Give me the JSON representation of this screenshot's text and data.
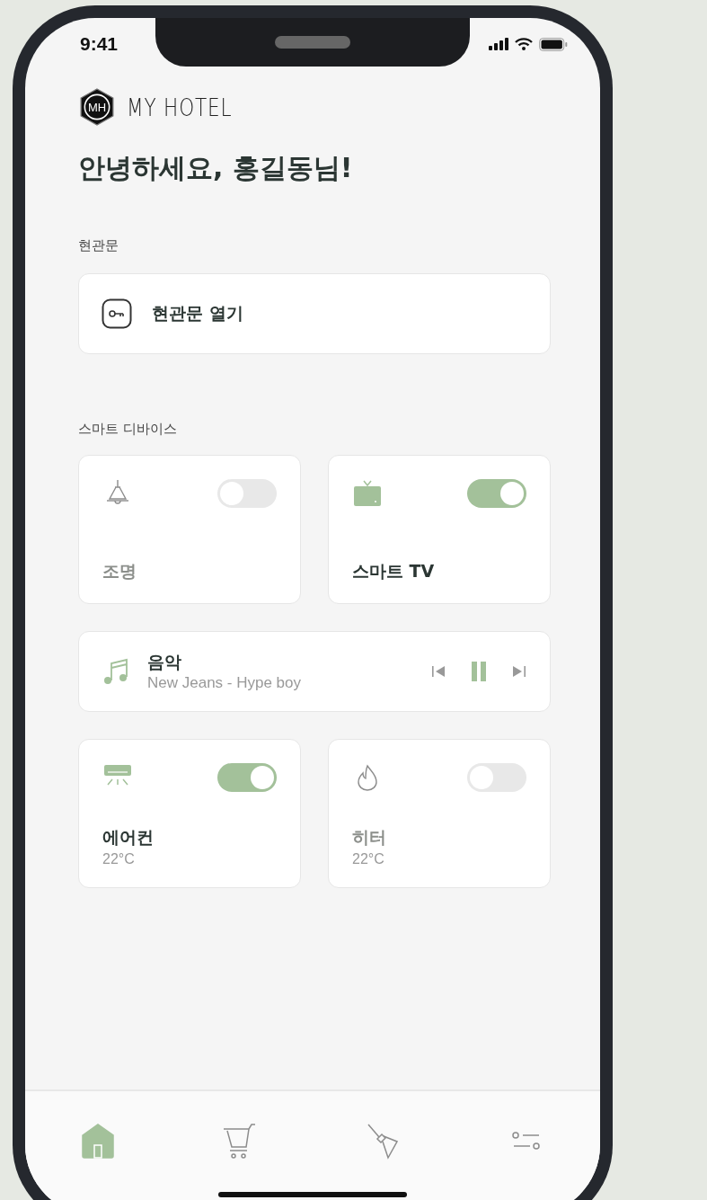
{
  "status_bar": {
    "time": "9:41"
  },
  "logo": {
    "monogram": "MH",
    "text": "MY HOTEL"
  },
  "greeting": "안녕하세요, 홍길동님!",
  "entrance": {
    "section_label": "현관문",
    "action": "현관문 열기"
  },
  "devices": {
    "section_label": "스마트 디바이스",
    "items": [
      {
        "kind": "switch",
        "name": "조명",
        "on": false
      },
      {
        "kind": "switch",
        "name": "스마트 TV",
        "on": true
      },
      {
        "kind": "media",
        "name": "음악",
        "track": "New Jeans - Hype boy",
        "playing": true
      },
      {
        "kind": "switch",
        "name": "에어컨",
        "reading": "22°C",
        "on": true
      },
      {
        "kind": "switch",
        "name": "히터",
        "reading": "22°C",
        "on": false
      }
    ]
  },
  "nav": [
    {
      "selected": true
    },
    {
      "selected": false
    },
    {
      "selected": false
    },
    {
      "selected": false
    }
  ]
}
